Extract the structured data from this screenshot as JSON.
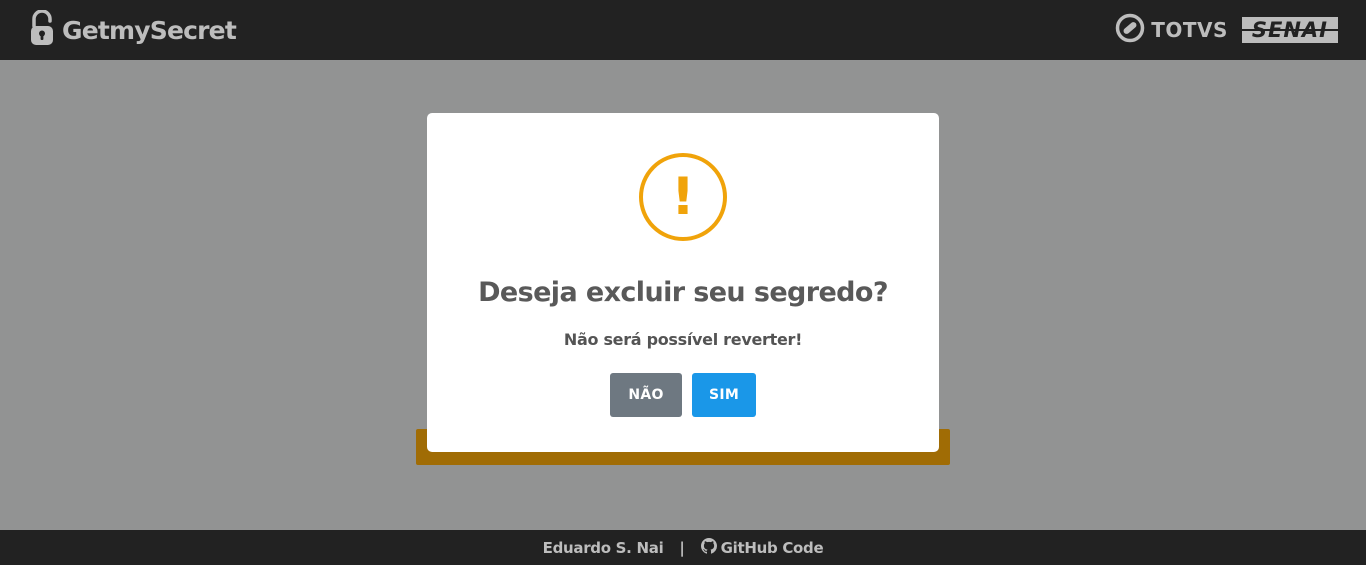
{
  "header": {
    "brand_name": "GetmySecret",
    "partner_totvs": "TOTVS",
    "partner_senai": "SENAI"
  },
  "modal": {
    "icon_symbol": "!",
    "icon_name": "warning-icon",
    "title": "Deseja excluir seu segredo?",
    "text": "Não será possível reverter!",
    "cancel_label": "NÃO",
    "confirm_label": "SIM"
  },
  "footer": {
    "author": "Eduardo S. Nai",
    "separator": "|",
    "github_label": "GitHub Code"
  },
  "colors": {
    "header_bg": "#222222",
    "overlay_bg": "#929393",
    "warning": "#f0a30a",
    "confirm_button": "#1a97e8",
    "cancel_button": "#6e7881",
    "card_accent": "#a06c05"
  }
}
